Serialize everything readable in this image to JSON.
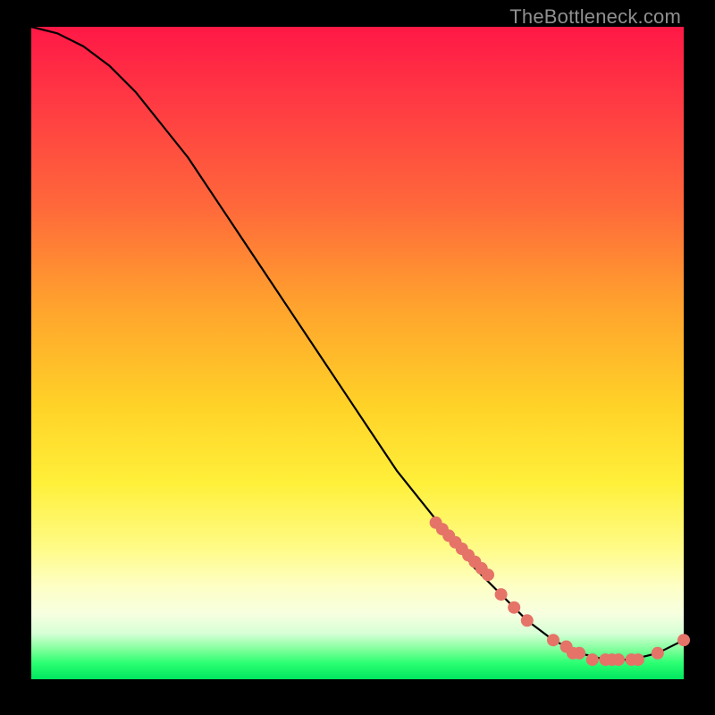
{
  "watermark": "TheBottleneck.com",
  "chart_data": {
    "type": "line",
    "title": "",
    "xlabel": "",
    "ylabel": "",
    "xlim": [
      0,
      100
    ],
    "ylim": [
      0,
      100
    ],
    "grid": false,
    "legend": false,
    "background_gradient": {
      "top": "#ff1846",
      "bottom": "#00e65e",
      "stops": [
        "red",
        "orange",
        "yellow",
        "pale",
        "green"
      ]
    },
    "series": [
      {
        "name": "bottleneck-curve",
        "type": "line",
        "x": [
          0,
          4,
          8,
          12,
          16,
          20,
          24,
          28,
          32,
          36,
          40,
          44,
          48,
          52,
          56,
          60,
          64,
          68,
          72,
          76,
          80,
          84,
          88,
          92,
          96,
          100
        ],
        "y": [
          100,
          99,
          97,
          94,
          90,
          85,
          80,
          74,
          68,
          62,
          56,
          50,
          44,
          38,
          32,
          27,
          22,
          17,
          13,
          9,
          6,
          4,
          3,
          3,
          4,
          6
        ]
      },
      {
        "name": "highlighted-points",
        "type": "scatter",
        "x": [
          62,
          63,
          64,
          65,
          66,
          67,
          68,
          69,
          70,
          72,
          74,
          76,
          80,
          82,
          83,
          84,
          86,
          88,
          89,
          90,
          92,
          93,
          96,
          100
        ],
        "y": [
          24,
          23,
          22,
          21,
          20,
          19,
          18,
          17,
          16,
          13,
          11,
          9,
          6,
          5,
          4,
          4,
          3,
          3,
          3,
          3,
          3,
          3,
          4,
          6
        ]
      }
    ]
  }
}
